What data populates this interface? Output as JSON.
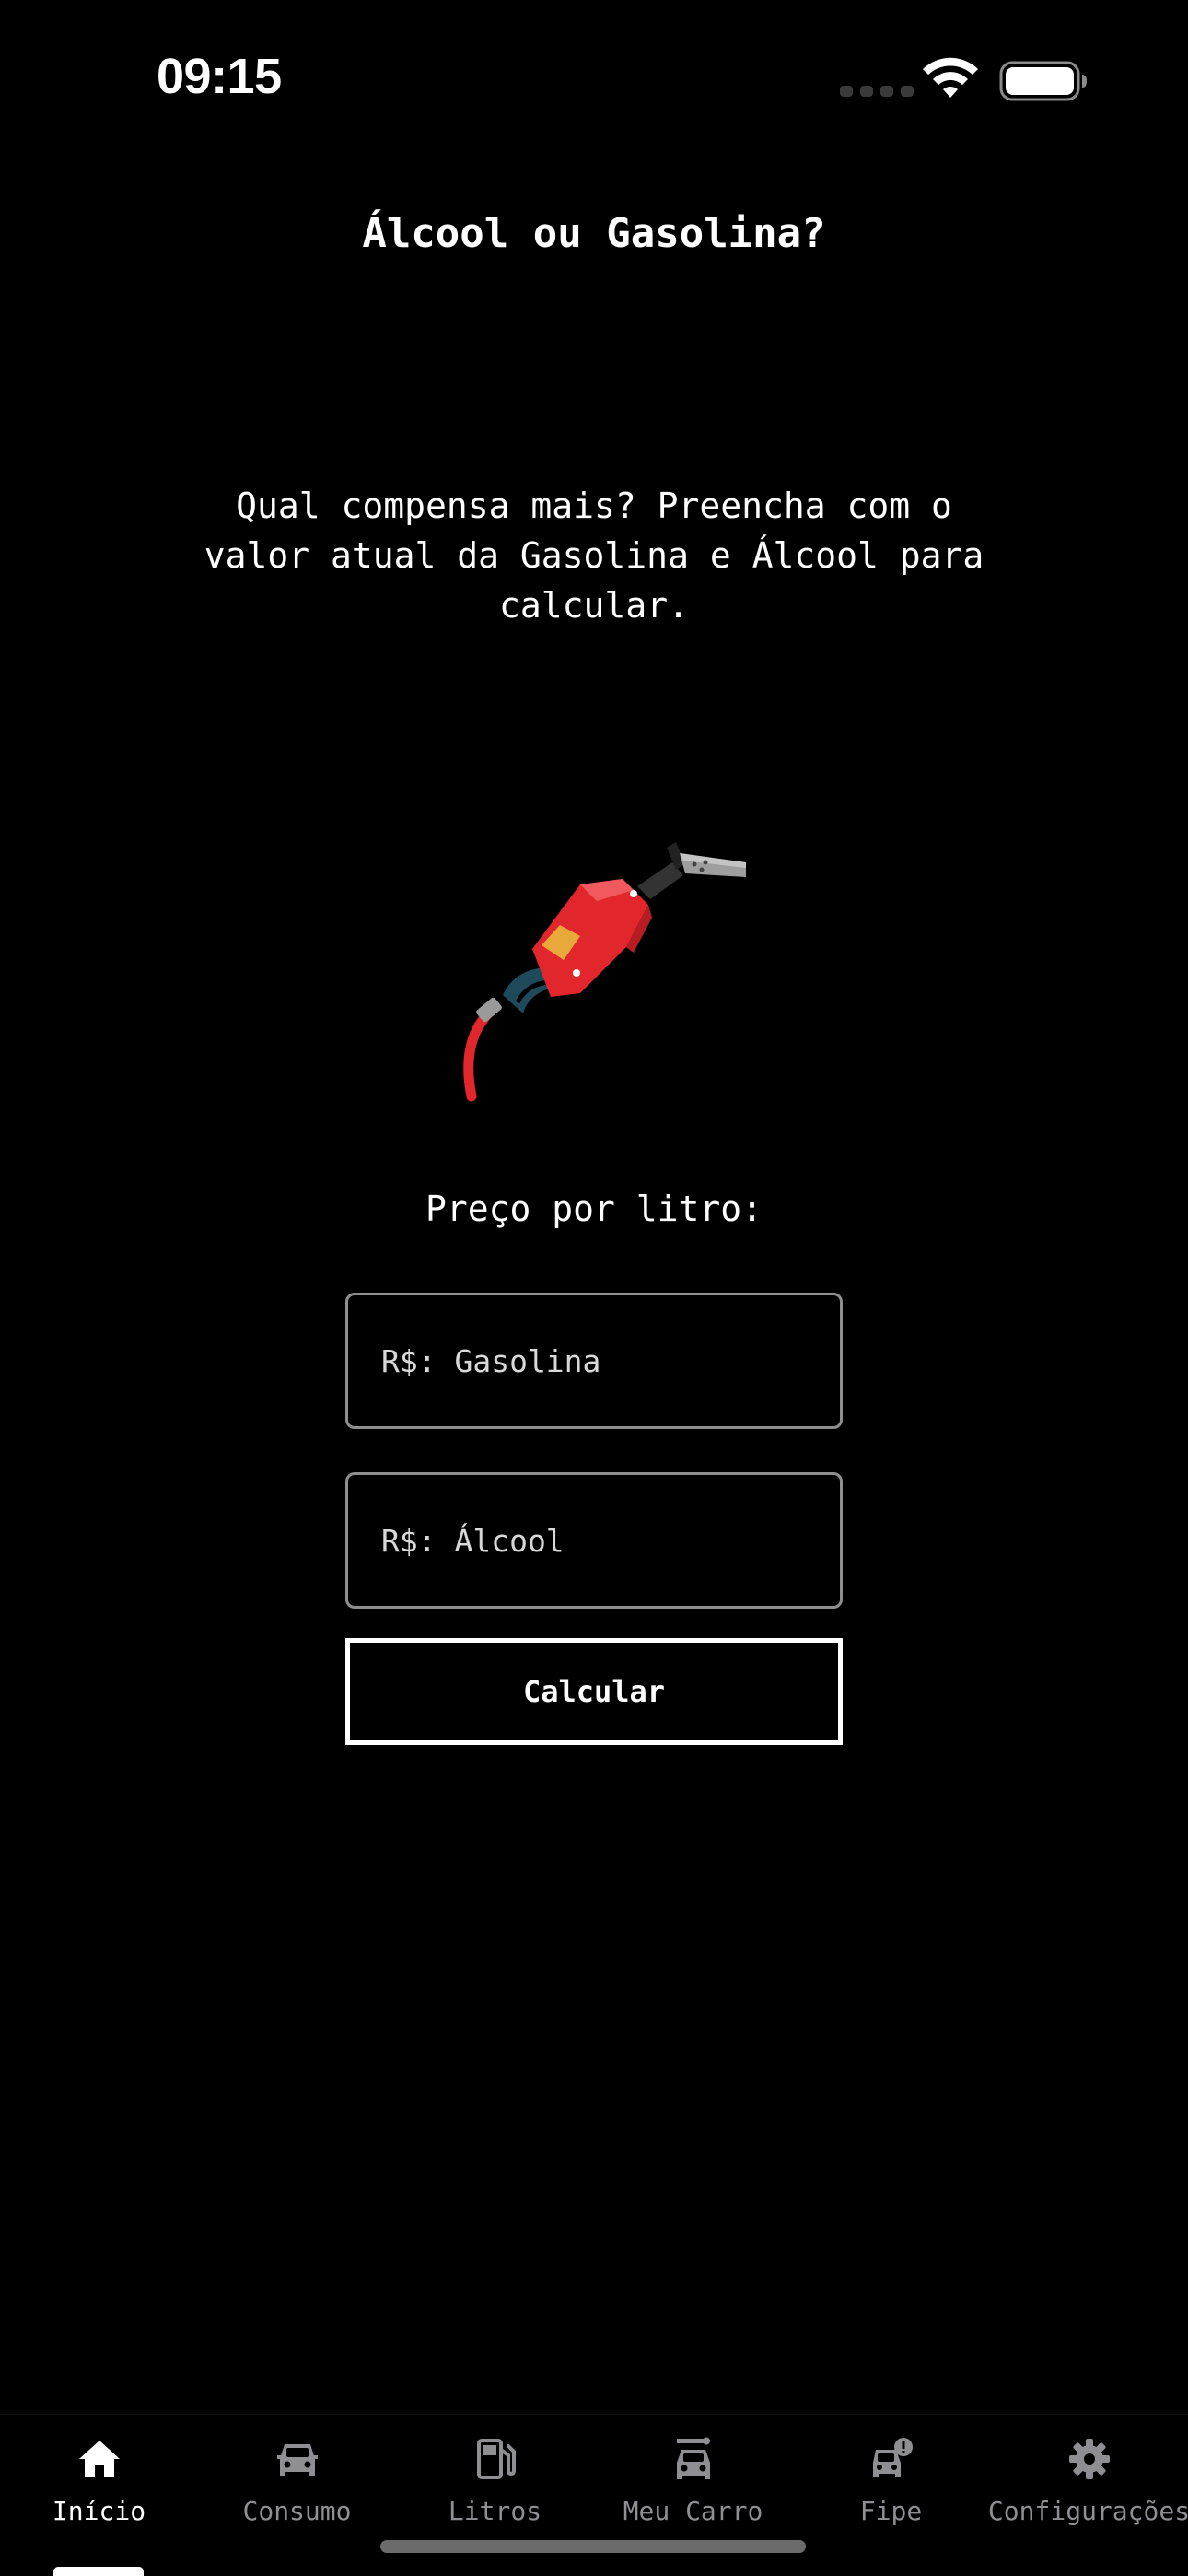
{
  "status_bar": {
    "time": "09:15",
    "icons": [
      "signal-dots-icon",
      "wifi-icon",
      "battery-icon"
    ]
  },
  "header": {
    "title": "Álcool ou Gasolina?"
  },
  "main": {
    "description": "Qual compensa mais? Preencha com o valor atual da Gasolina e Álcool para calcular.",
    "illustration": "fuel-pump-nozzle-icon",
    "price_label": "Preço por litro:",
    "gasolina_input": {
      "placeholder": "R$: Gasolina",
      "value": ""
    },
    "alcool_input": {
      "placeholder": "R$: Álcool",
      "value": ""
    },
    "calculate_button": "Calcular"
  },
  "tab_bar": {
    "tabs": [
      {
        "label": "Início",
        "icon": "home-icon",
        "active": true
      },
      {
        "label": "Consumo",
        "icon": "car-icon",
        "active": false
      },
      {
        "label": "Litros",
        "icon": "fuel-icon",
        "active": false
      },
      {
        "label": "Meu Carro",
        "icon": "car-garage-icon",
        "active": false
      },
      {
        "label": "Fipe",
        "icon": "car-alert-icon",
        "active": false
      },
      {
        "label": "Configurações",
        "icon": "gear-icon",
        "active": false
      }
    ]
  },
  "colors": {
    "background": "#000000",
    "text": "#ffffff",
    "inactive_tab": "#8e8e93",
    "input_border": "#8e8e8e",
    "pump_red": "#e2272c"
  }
}
